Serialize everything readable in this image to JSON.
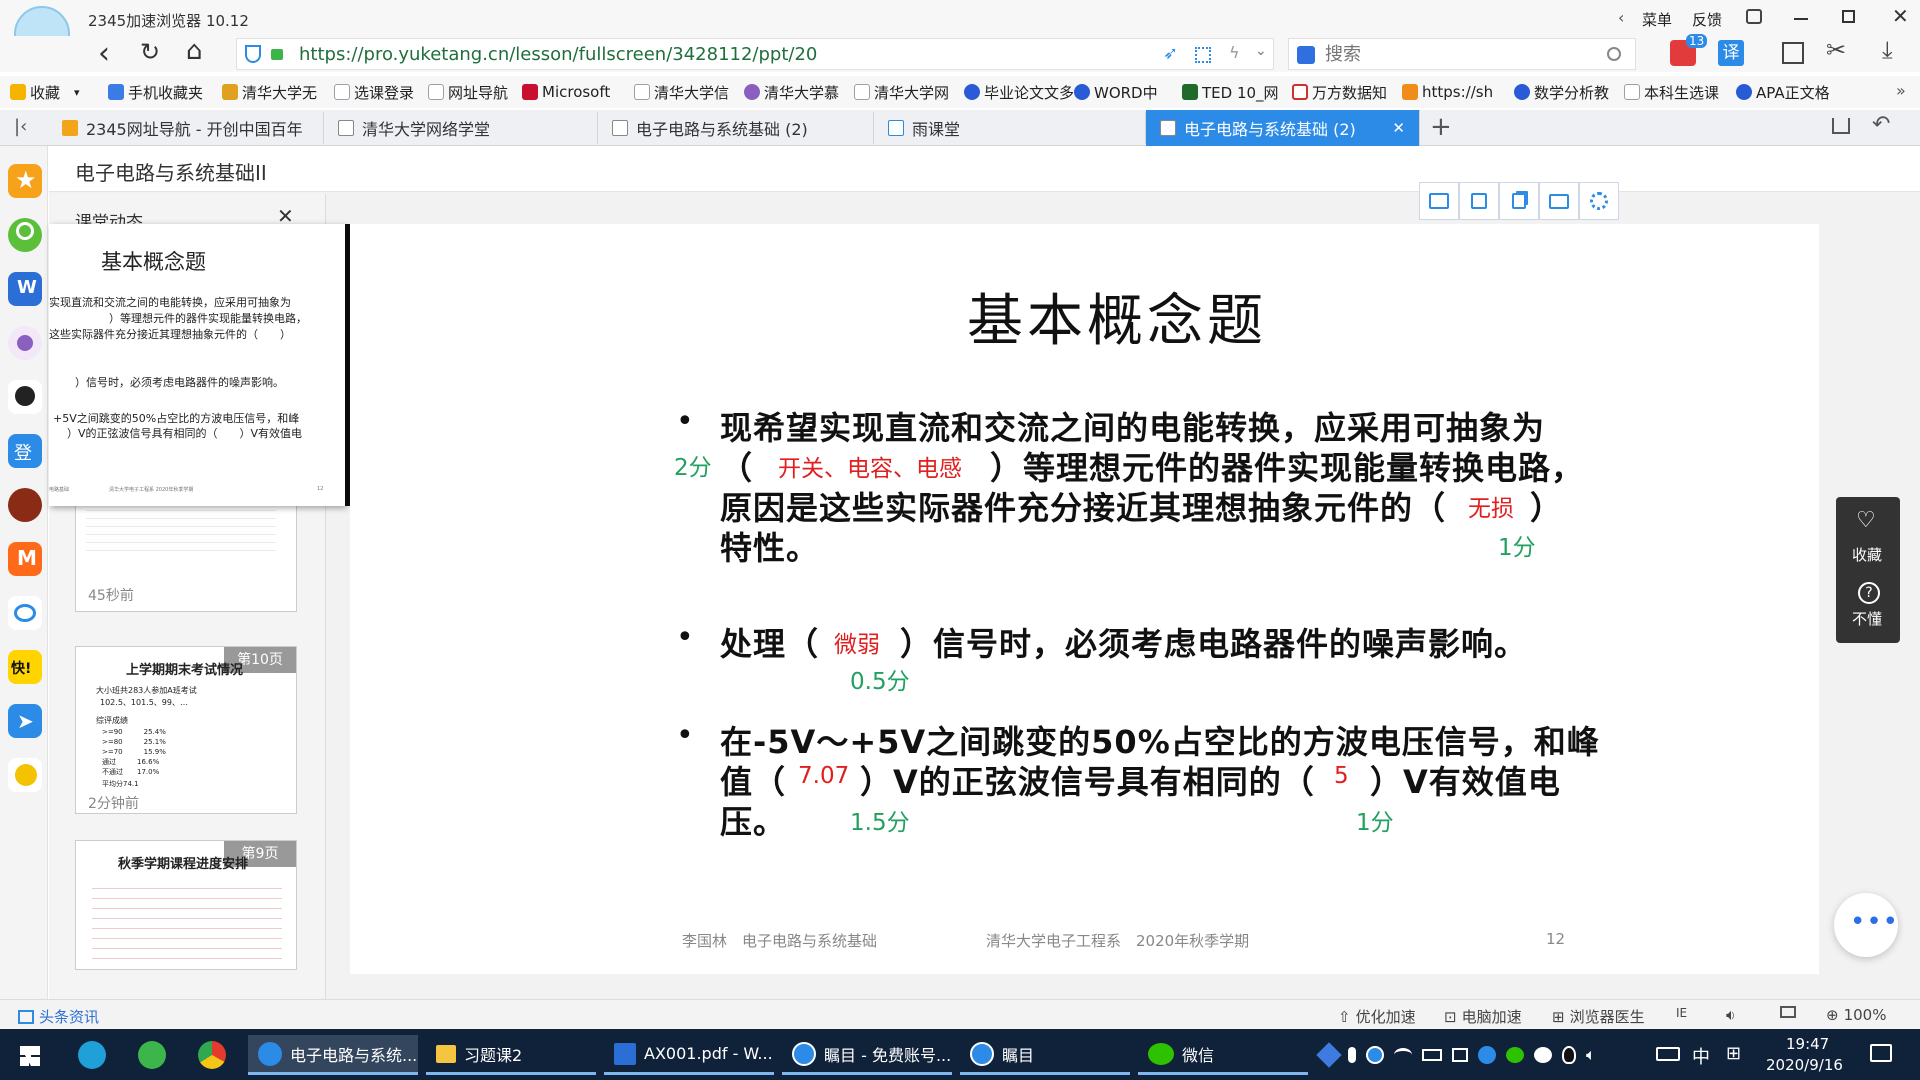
{
  "browser": {
    "title": "2345加速浏览器 10.12",
    "login_label": "登录",
    "menu_label": "菜单",
    "feedback_label": "反馈",
    "url": "https://pro.yuketang.cn/lesson/fullscreen/3428112/ppt/20",
    "search_placeholder": "搜索",
    "notify_count": "13",
    "translate_label": "译"
  },
  "favorites": [
    {
      "label": "收藏",
      "color": "#f5b400"
    },
    {
      "label": "手机收藏夹",
      "color": "#3b7be6"
    },
    {
      "label": "清华大学无",
      "color": "#e0a020"
    },
    {
      "label": "选课登录",
      "color": "#9aa0a6"
    },
    {
      "label": "网址导航",
      "color": "#9aa0a6"
    },
    {
      "label": "Microsoft",
      "color": "#c8102e"
    },
    {
      "label": "清华大学信",
      "color": "#9aa0a6"
    },
    {
      "label": "清华大学慕",
      "color": "#8b5fbf"
    },
    {
      "label": "清华大学网",
      "color": "#9aa0a6"
    },
    {
      "label": "毕业论文文多",
      "color": "#2a5bd7"
    },
    {
      "label": "WORD中",
      "color": "#2a5bd7"
    },
    {
      "label": "TED 10_网",
      "color": "#1f6b2a"
    },
    {
      "label": "万方数据知",
      "color": "#d0312d"
    },
    {
      "label": "https://sh",
      "color": "#f08c1a"
    },
    {
      "label": "数学分析教",
      "color": "#2a5bd7"
    },
    {
      "label": "本科生选课",
      "color": "#9aa0a6"
    },
    {
      "label": "APA正文格",
      "color": "#2a5bd7"
    }
  ],
  "tabs": [
    {
      "label": "2345网址导航 - 开创中国百年"
    },
    {
      "label": "清华大学网络学堂"
    },
    {
      "label": "电子电路与系统基础 (2)"
    },
    {
      "label": "雨课堂"
    },
    {
      "label": "电子电路与系统基础 (2)"
    }
  ],
  "course_title": "电子电路与系统基础II",
  "panel": {
    "header": "课堂动态",
    "preview_title": "基本概念题",
    "preview_lines": [
      "实现直流和交流之间的电能转换，应采用可抽象为",
      "）等理想元件的器件实现能量转换电路，",
      "这些实际器件充分接近其理想抽象元件的（　　）",
      "）信号时，必须考虑电路器件的噪声影响。",
      "+5V之间跳变的50%占空比的方波电压信号，和峰",
      "）V的正弦波信号具有相同的（　　）V有效值电"
    ],
    "preview_footer_left": "电路基础",
    "preview_footer_mid": "清华大学电子工程系 2020年秋季学期",
    "preview_footer_right": "12",
    "items": [
      {
        "time": "45秒前",
        "title": "",
        "badge": ""
      },
      {
        "time": "2分钟前",
        "title": "上学期期末考试情况",
        "badge": "第10页",
        "lines": [
          "大小班共283人参加A班考试",
          "102.5、101.5、99、…",
          "综评成绩",
          ">=90　　　25.4%",
          ">=80　　　25.1%",
          ">=70　　　15.9%",
          "通过　　　16.6%",
          "不通过　　17.0%",
          "平均分74.1"
        ]
      },
      {
        "time": "",
        "title": "秋季学期课程进度安排",
        "badge": "第9页"
      }
    ]
  },
  "slide": {
    "title": "基本概念题",
    "q1_line1": "现希望实现直流和交流之间的电能转换，应采用可抽象为",
    "q1_line2_pre": "（",
    "q1_line2_post": "）等理想元件的器件实现能量转换电路，",
    "q1_line3_pre": "原因是这些实际器件充分接近其理想抽象元件的（",
    "q1_line3_post": "）",
    "q1_line4": "特性。",
    "q1_ans1": "开关、电容、电感",
    "q1_ans2": "无损",
    "q1_score1": "2分",
    "q1_score2": "1分",
    "q2_pre": "处理（",
    "q2_post": "）信号时，必须考虑电路器件的噪声影响。",
    "q2_ans": "微弱",
    "q2_score": "0.5分",
    "q3_line1": "在-5V～+5V之间跳变的50%占空比的方波电压信号，和峰",
    "q3_line2_a": "值（",
    "q3_line2_b": "）V的正弦波信号具有相同的（",
    "q3_line2_c": "）V有效值电",
    "q3_line3": "压。",
    "q3_ans1": "7.07",
    "q3_ans2": "5",
    "q3_score1": "1.5分",
    "q3_score2": "1分",
    "footer_author": "李国林　电子电路与系统基础",
    "footer_dept": "清华大学电子工程系　2020年秋季学期",
    "footer_page": "12"
  },
  "side_actions": {
    "collect": "收藏",
    "confused": "不懂"
  },
  "status": {
    "news": "头条资讯",
    "optimize": "优化加速",
    "pc_speed": "电脑加速",
    "doctor": "浏览器医生",
    "zoom": "100%"
  },
  "taskbar": {
    "items": [
      "电子电路与系统...",
      "习题课2",
      "AX001.pdf - W...",
      "瞩目 - 免费账号...",
      "瞩目",
      "微信"
    ],
    "ime": "中",
    "time": "19:47",
    "date": "2020/9/16"
  }
}
